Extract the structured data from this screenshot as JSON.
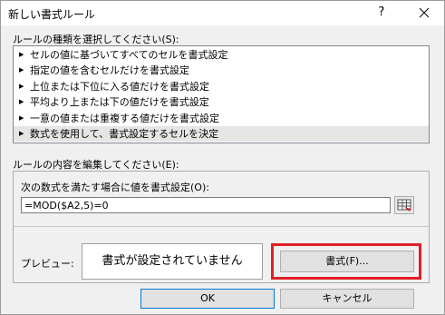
{
  "window": {
    "title": "新しい書式ルール",
    "help_label": "?"
  },
  "rule_type": {
    "label": "ルールの種類を選択してください(S):",
    "items": [
      {
        "label": "セルの値に基づいてすべてのセルを書式設定"
      },
      {
        "label": "指定の値を含むセルだけを書式設定"
      },
      {
        "label": "上位または下位に入る値だけを書式設定"
      },
      {
        "label": "平均より上または下の値だけを書式設定"
      },
      {
        "label": "一意の値または重複する値だけを書式設定"
      },
      {
        "label": "数式を使用して、書式設定するセルを決定"
      }
    ],
    "selected_index": 5,
    "bullet": "▶"
  },
  "rule_edit": {
    "label": "ルールの内容を編集してください(E):",
    "formula_label": "次の数式を満たす場合に値を書式設定(O):",
    "formula_value": "=MOD($A2,5)=0",
    "preview_label": "プレビュー:",
    "preview_text": "書式が設定されていません",
    "format_button": "書式(F)...",
    "highlight_color": "#e01e26"
  },
  "buttons": {
    "ok": "OK",
    "cancel": "キャンセル"
  }
}
